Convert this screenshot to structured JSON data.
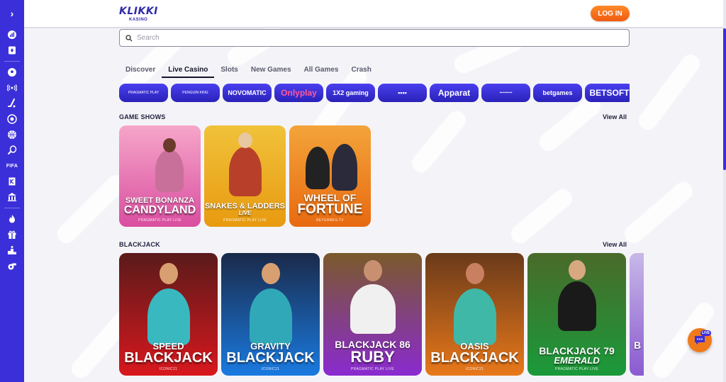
{
  "sidebar": {
    "toggle_glyph": "›",
    "fifa_label": "FIFA",
    "icons": [
      "chart-icon",
      "card-icon",
      "soccer-icon",
      "live-signal-icon",
      "hockey-icon",
      "target-icon",
      "basketball-icon",
      "tennis-icon",
      "fifa-icon",
      "kiosk-icon",
      "casino-icon",
      "fire-icon",
      "gift-icon",
      "podium-icon",
      "whistle-icon"
    ]
  },
  "header": {
    "logo_text": "KLIKKI",
    "logo_sub": "KASINO",
    "login_label": "LOG IN"
  },
  "search": {
    "placeholder": "Search"
  },
  "tabs": [
    {
      "label": "Discover",
      "active": false
    },
    {
      "label": "Live Casino",
      "active": true
    },
    {
      "label": "Slots",
      "active": false
    },
    {
      "label": "New Games",
      "active": false
    },
    {
      "label": "All Games",
      "active": false
    },
    {
      "label": "Crash",
      "active": false
    }
  ],
  "providers": [
    {
      "name": "PRAGMATIC PLAY",
      "style": "small"
    },
    {
      "name": "PENGUIN KING",
      "style": "small"
    },
    {
      "name": "NOVOMATIC",
      "style": "normal"
    },
    {
      "name": "Onlyplay",
      "style": "big"
    },
    {
      "name": "1X2 gaming",
      "style": "normal"
    },
    {
      "name": "▪▪▪▪",
      "style": "normal"
    },
    {
      "name": "Apparat",
      "style": "big"
    },
    {
      "name": "▪▪▪▪▪▪▪▪▪▪",
      "style": "small"
    },
    {
      "name": "betgames",
      "style": "normal"
    },
    {
      "name": "BETSOFT",
      "style": "big"
    }
  ],
  "sections": {
    "game_shows": {
      "title": "GAME SHOWS",
      "view_all": "View All"
    },
    "blackjack": {
      "title": "BLACKJACK",
      "view_all": "View All"
    }
  },
  "game_shows": [
    {
      "line1": "SWEET BONANZA",
      "line2": "CANDYLAND",
      "provider": "PRAGMATIC PLAY LIVE",
      "bg_top": "#f6a6c9",
      "bg_bottom": "#d94ea0"
    },
    {
      "line1": "SNAKES & LADDERS",
      "line2": "LIVE",
      "provider": "PRAGMATIC PLAY LIVE",
      "bg_top": "#f0c23a",
      "bg_bottom": "#e89a10"
    },
    {
      "line1": "WHEEL OF",
      "line2": "FORTUNE",
      "provider": "BETGAMES.TV",
      "bg_top": "#f3a43a",
      "bg_bottom": "#e86a10"
    }
  ],
  "blackjack": [
    {
      "line1": "SPEED",
      "line2": "BLACKJACK",
      "provider": "ICONIC21",
      "bg_top": "#5a1a1a",
      "bg_bottom": "#d8181e"
    },
    {
      "line1": "GRAVITY",
      "line2": "BLACKJACK",
      "provider": "ICONIC21",
      "bg_top": "#1a2a4a",
      "bg_bottom": "#1a7ae0"
    },
    {
      "line1": "BLACKJACK 86",
      "line2": "RUBY",
      "provider": "PRAGMATIC PLAY LIVE",
      "bg_top": "#7a5a2a",
      "bg_bottom": "#8a2ad0"
    },
    {
      "line1": "OASIS",
      "line2": "BLACKJACK",
      "provider": "ICONIC21",
      "bg_top": "#6a3a1a",
      "bg_bottom": "#e8781a"
    },
    {
      "line1": "BLACKJACK 79",
      "line2": "EMERALD",
      "provider": "PRAGMATIC PLAY LIVE",
      "bg_top": "#4a6a2a",
      "bg_bottom": "#1a9a3a"
    },
    {
      "line1": "B",
      "line2": "",
      "provider": "",
      "bg_top": "#c8b8e8",
      "bg_bottom": "#8a5ad0"
    }
  ],
  "chat": {
    "badge": "LIVE"
  }
}
